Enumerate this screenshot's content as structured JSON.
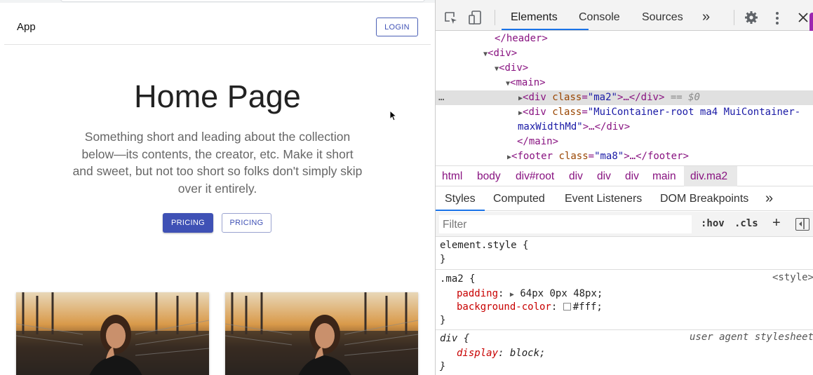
{
  "page": {
    "app_title": "App",
    "login_label": "LOGIN",
    "hero_title": "Home Page",
    "hero_body": "Something short and leading about the collection below—its contents, the creator, etc. Make it short and sweet, but not too short so folks don't simply skip over it entirely.",
    "primary_button": "PRICING",
    "secondary_button": "PRICING",
    "accent_color": "#3f51b5"
  },
  "devtools": {
    "tabs": [
      "Elements",
      "Console",
      "Sources"
    ],
    "more_tabs": "»",
    "dom": {
      "header_close": "</header>",
      "div1": "<div>",
      "div2": "<div>",
      "main_open": "<main>",
      "sel_div_tag": "<div",
      "sel_attr": "class",
      "sel_val": "\"ma2\"",
      "sel_tail": ">…</div>",
      "sel_eq": "== $0",
      "container_tag": "<div",
      "container_attr": "class",
      "container_val": "\"MuiContainer-root ma4 MuiContainer-",
      "container_val2": "maxWidthMd\"",
      "container_tail": ">…</div>",
      "main_close": "</main>",
      "footer_tag": "<footer",
      "footer_attr": "class",
      "footer_val": "\"ma8\"",
      "footer_tail": ">…</footer>",
      "ellipsis": "…"
    },
    "breadcrumbs": [
      "html",
      "body",
      "div#root",
      "div",
      "div",
      "div",
      "main",
      "div.ma2"
    ],
    "sub_tabs": [
      "Styles",
      "Computed",
      "Event Listeners",
      "DOM Breakpoints"
    ],
    "sub_more": "»",
    "filter_placeholder": "Filter",
    "hov": ":hov",
    "cls": ".cls",
    "plus": "+",
    "rules": {
      "element_style_open": "element.style {",
      "close": "}",
      "ma2_selector": ".ma2 {",
      "ma2_source": "<style>",
      "padding_prop": "padding",
      "padding_val": "64px 0px 48px;",
      "bg_prop": "background-color",
      "bg_val": "#fff;",
      "div_selector": "div {",
      "div_source": "user agent stylesheet",
      "display_prop": "display",
      "display_val": "block;"
    }
  }
}
